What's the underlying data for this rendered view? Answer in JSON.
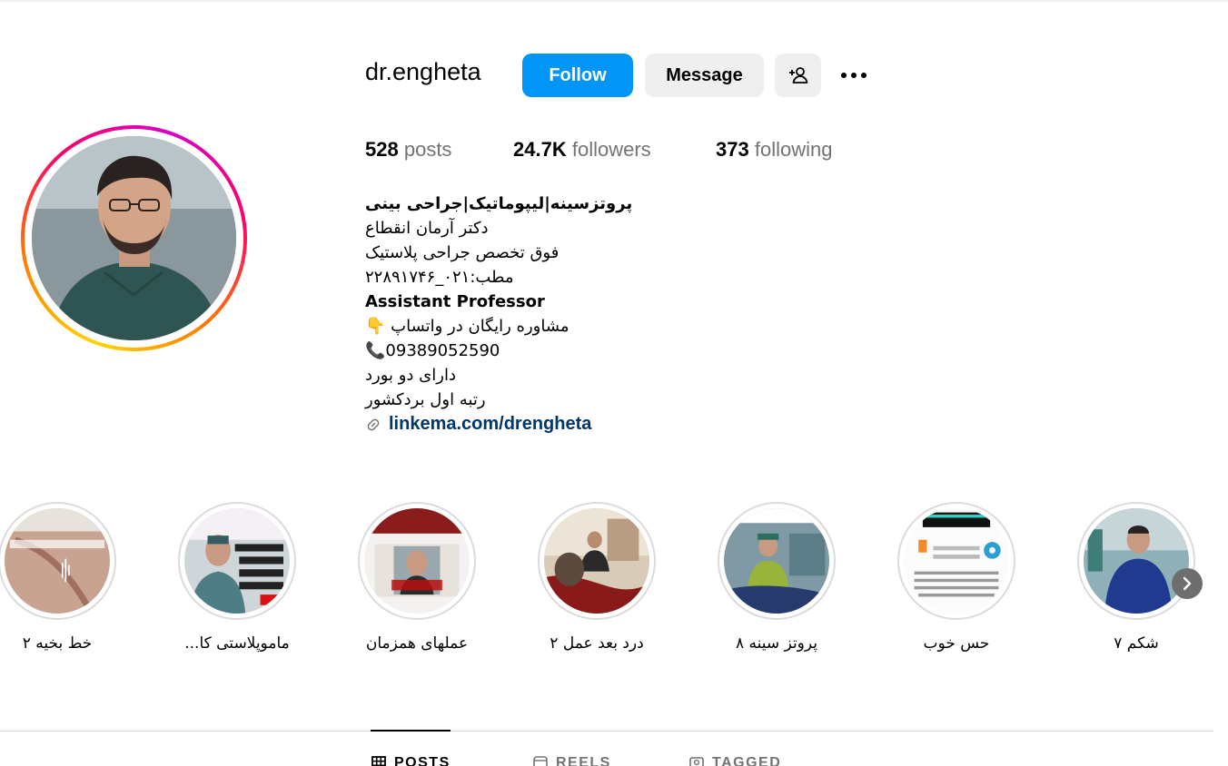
{
  "profile": {
    "username": "dr.engheta",
    "follow_label": "Follow",
    "message_label": "Message",
    "stats": {
      "posts_count": "528",
      "posts_label": "posts",
      "followers_count": "24.7K",
      "followers_label": "followers",
      "following_count": "373",
      "following_label": "following"
    },
    "bio": {
      "title": "پروتزسینه|لیپوماتیک|جراحی بینی",
      "line1": "دکتر آرمان انقطاع",
      "line2": "فوق تخصص جراحی پلاستیک",
      "line3": "مطب:۰۲۱_۲۲۸۹۱۷۴۶",
      "line4": "Assistant Professor",
      "line5": "مشاوره رایگان در واتساپ 👇",
      "line6": "📞09389052590",
      "line7": "دارای دو بورد",
      "line8": "رتبه اول بردکشور",
      "link": "linkema.com/drengheta"
    }
  },
  "highlights": [
    {
      "label": "خط بخیه ۲"
    },
    {
      "label": "ماموپلاستی کا..."
    },
    {
      "label": "عملهای همزمان"
    },
    {
      "label": "درد بعد عمل ۲"
    },
    {
      "label": "پروتز سینه ۸"
    },
    {
      "label": "حس خوب"
    },
    {
      "label": "شکم ۷"
    }
  ],
  "tabs": [
    {
      "label": "POSTS"
    },
    {
      "label": "REELS"
    },
    {
      "label": "TAGGED"
    }
  ],
  "colors": {
    "follow_button": "#0095f6",
    "secondary_button": "#efefef",
    "link": "#00376b"
  },
  "icons": {
    "add_user": "add-user-icon",
    "more": "more-options-icon",
    "link": "link-icon",
    "next": "chevron-right-icon"
  }
}
